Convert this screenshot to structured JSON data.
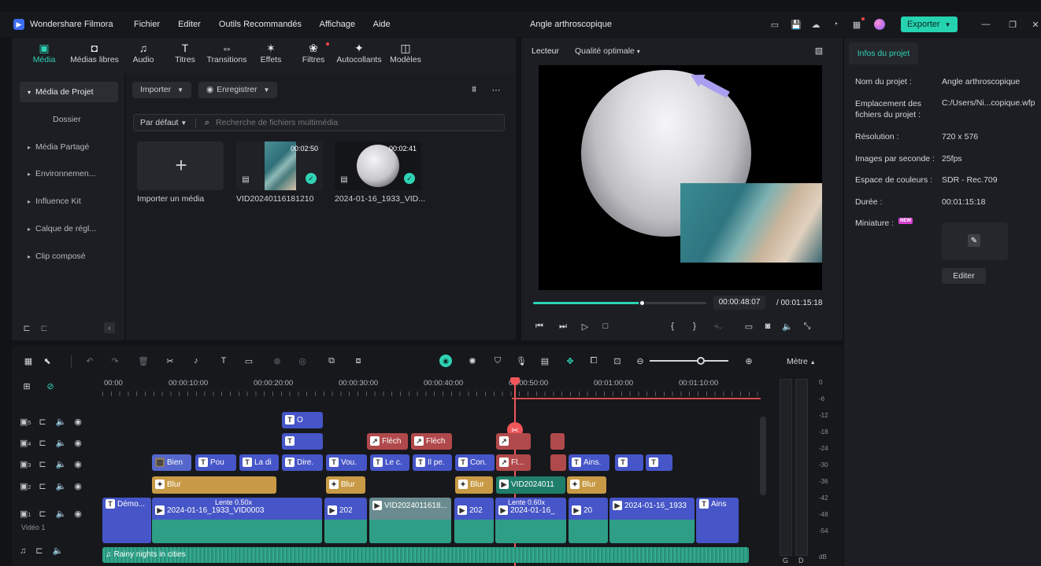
{
  "titlebar": {
    "app_name": "Wondershare Filmora",
    "menu": [
      "Fichier",
      "Editer",
      "Outils Recommandés",
      "Affichage",
      "Aide"
    ],
    "project_title": "Angle arthroscopique",
    "export_label": "Exporter"
  },
  "media_toolbar": {
    "items": [
      {
        "label": "Média",
        "icon": "media-icon"
      },
      {
        "label": "Médias libres",
        "icon": "stock-media-icon"
      },
      {
        "label": "Audio",
        "icon": "music-note-icon"
      },
      {
        "label": "Titres",
        "icon": "text-icon"
      },
      {
        "label": "Transitions",
        "icon": "transition-icon"
      },
      {
        "label": "Effets",
        "icon": "effects-icon"
      },
      {
        "label": "Filtres",
        "icon": "filters-icon"
      },
      {
        "label": "Autocollants",
        "icon": "sticker-icon"
      },
      {
        "label": "Modèles",
        "icon": "template-icon"
      }
    ]
  },
  "sidebar": {
    "items": [
      {
        "label": "Média de Projet"
      },
      {
        "label": "Dossier"
      },
      {
        "label": "Média Partagé"
      },
      {
        "label": "Environnemen..."
      },
      {
        "label": "Influence Kit"
      },
      {
        "label": "Calque de régl..."
      },
      {
        "label": "Clip composé"
      }
    ]
  },
  "media": {
    "import_label": "Importer",
    "record_label": "Enregistrer",
    "sort_label": "Par défaut",
    "search_placeholder": "Recherche de fichiers multimédia",
    "import_tile_label": "Importer un média",
    "files": [
      {
        "name": "VID20240116181210",
        "duration": "00:02:50"
      },
      {
        "name": "2024-01-16_1933_VID...",
        "duration": "00:02:41"
      }
    ]
  },
  "preview": {
    "player_label": "Lecteur",
    "quality_label": "Qualité optimale",
    "current_time": "00:00:48:07",
    "total_time": "/ 00:01:15:18",
    "progress": 0.63
  },
  "info": {
    "tab": "Infos du projet",
    "rows": [
      {
        "key": "Nom du projet :",
        "value": "Angle arthroscopique"
      },
      {
        "key": "Emplacement des fichiers du projet :",
        "value": "C:/Users/Ni...copique.wfp"
      },
      {
        "key": "Résolution :",
        "value": "720 x 576"
      },
      {
        "key": "Images par seconde :",
        "value": "25fps"
      },
      {
        "key": "Espace de couleurs :",
        "value": "SDR - Rec.709"
      },
      {
        "key": "Durée :",
        "value": "00:01:15:18"
      }
    ],
    "thumbnail_label": "Miniature :",
    "new_badge": "NEW",
    "edit_label": "Editer"
  },
  "timeline": {
    "ruler": [
      "00:00",
      "00:00:10:00",
      "00:00:20:00",
      "00:00:30:00",
      "00:00:40:00",
      "00:00:50:00",
      "00:01:00:00",
      "00:01:10:00"
    ],
    "meter_label": "Mètre",
    "meter_scale": [
      "0",
      "-6",
      "-12",
      "-18",
      "-24",
      "-30",
      "-36",
      "-42",
      "-48",
      "-54",
      "dB"
    ],
    "meter_channels": [
      "G",
      "D"
    ],
    "video1_label": "Vidéo 1",
    "track_numbers": [
      "5",
      "4",
      "3",
      "2",
      "1"
    ],
    "speed_labels": [
      "Lente 0.50x",
      "Lente 0.60x"
    ],
    "audio_clip": "Rainy nights in cities",
    "clips": {
      "t5": [
        "O"
      ],
      "t4": [
        "Flèch",
        "Flèch",
        "Fl..."
      ],
      "t3": [
        "Bien",
        "Pou",
        "La di",
        "Dire.",
        "Vou.",
        "Le c.",
        "Il pe.",
        "Con.",
        "Fl...",
        "Ains."
      ],
      "t2": [
        "Blur",
        "Blur",
        "Blur",
        "VID2024011",
        "Blur"
      ],
      "t1": [
        "Démo...",
        "2024-01-16_1933_VID0003",
        "202",
        "VID2024011618...",
        "202",
        "2024-01-16_",
        "20",
        "2024-01-16_1933",
        "Ains"
      ]
    }
  }
}
